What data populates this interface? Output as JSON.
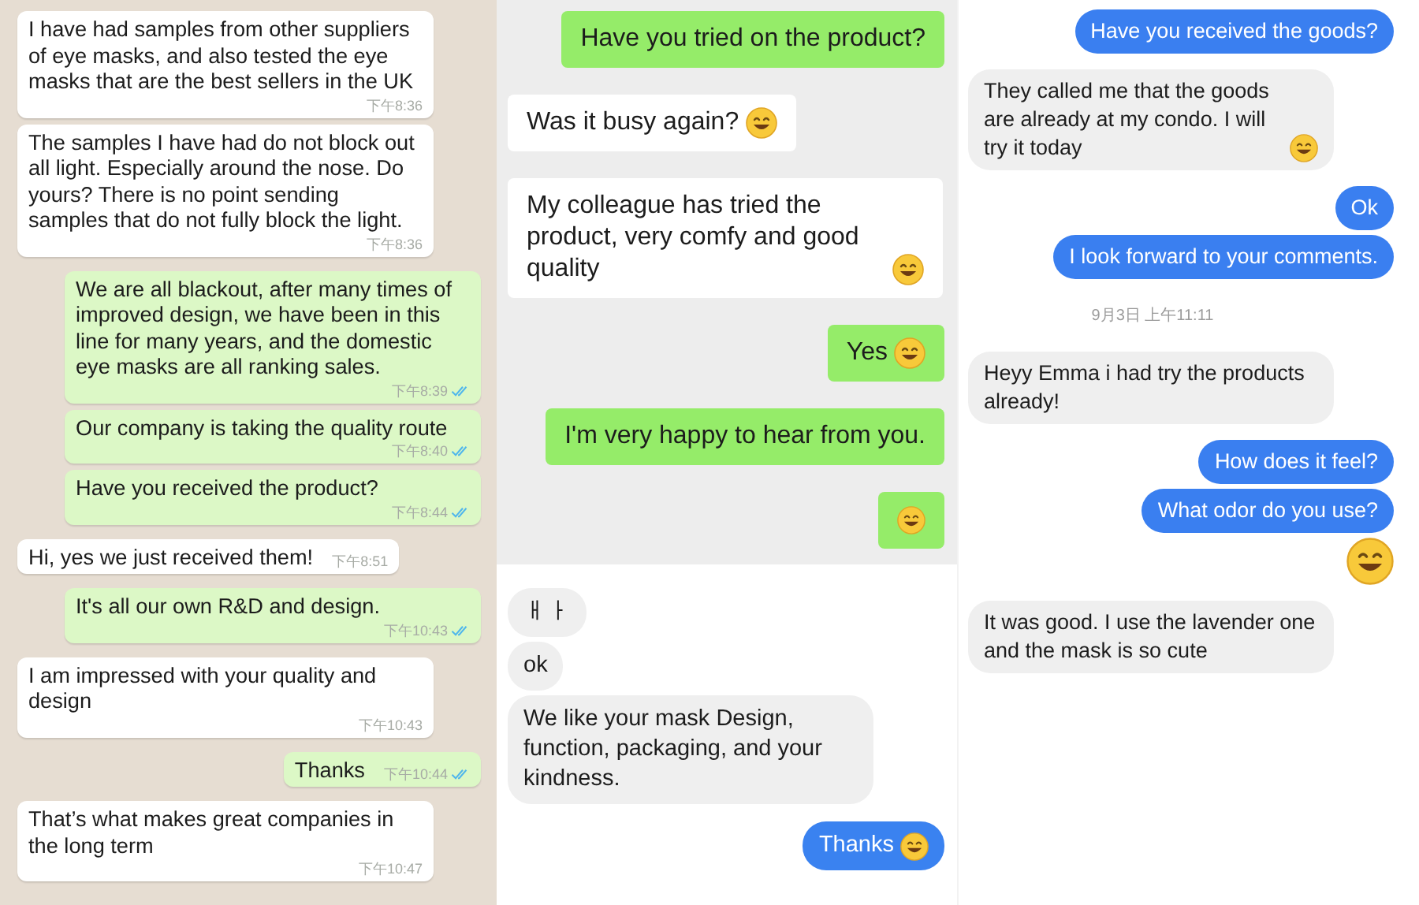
{
  "columns": [
    {
      "sections": [
        {
          "kind": "whatsapp",
          "messages": [
            {
              "kind": "message",
              "outgoing": false,
              "text": "I have had samples from other suppliers of eye masks, and also tested the eye masks that are the best sellers in the UK",
              "time": "下午8:36"
            },
            {
              "kind": "message",
              "outgoing": false,
              "text": "The samples I have had do not block out all light. Especially around the nose. Do yours? There is no point sending samples that do not fully block the light.",
              "time": "下午8:36"
            },
            {
              "kind": "message",
              "outgoing": true,
              "text": "We are all blackout, after many times of improved design, we have been in this line for many years, and the domestic eye masks are all ranking sales.",
              "time": "下午8:39",
              "read": true
            },
            {
              "kind": "message",
              "outgoing": true,
              "text": "Our company is taking the quality route",
              "time": "下午8:40",
              "read": true
            },
            {
              "kind": "message",
              "outgoing": true,
              "text": "Have you received the product?",
              "time": "下午8:44",
              "read": true
            },
            {
              "kind": "message",
              "outgoing": false,
              "text": "Hi, yes we just received them!",
              "time": "下午8:51"
            },
            {
              "kind": "message",
              "outgoing": true,
              "text": "It's all our own R&D and design.",
              "time": "下午10:43",
              "read": true
            },
            {
              "kind": "message",
              "outgoing": false,
              "text": "I am impressed with your quality and design",
              "time": "下午10:43"
            },
            {
              "kind": "message",
              "outgoing": true,
              "text": "Thanks",
              "time": "下午10:44",
              "read": true
            },
            {
              "kind": "message",
              "outgoing": false,
              "text": "That’s what makes great companies in the long term",
              "time": "下午10:47"
            }
          ]
        }
      ]
    },
    {
      "sections": [
        {
          "kind": "wechat",
          "messages": [
            {
              "kind": "message",
              "outgoing": true,
              "text": "Have you tried on the product?",
              "emoji": false
            },
            {
              "kind": "message",
              "outgoing": false,
              "text": "Was it busy again?",
              "emoji": true
            },
            {
              "kind": "message",
              "outgoing": false,
              "text": "My colleague has tried the product, very comfy and good quality",
              "emoji": true
            },
            {
              "kind": "message",
              "outgoing": true,
              "text": "Yes",
              "emoji": true
            },
            {
              "kind": "message",
              "outgoing": true,
              "text": "I'm very happy to hear from you.",
              "emoji": false
            },
            {
              "kind": "message",
              "outgoing": true,
              "emoji": true
            }
          ]
        },
        {
          "kind": "imessage",
          "messages": [
            {
              "kind": "message",
              "outgoing": false,
              "text": "ㅐㅏ",
              "emoji": false
            },
            {
              "kind": "message",
              "outgoing": false,
              "text": "ok",
              "emoji": false
            },
            {
              "kind": "message",
              "outgoing": false,
              "text": "We like your mask Design, function, packaging, and your kindness.",
              "emoji": false
            },
            {
              "kind": "message",
              "outgoing": true,
              "text": "Thanks",
              "emoji": true
            }
          ]
        }
      ]
    },
    {
      "sections": [
        {
          "kind": "messenger",
          "messages": [
            {
              "kind": "message",
              "outgoing": true,
              "text": "Have you received the goods?",
              "emoji": false
            },
            {
              "kind": "message",
              "outgoing": false,
              "text": "They called me that the goods are already at my condo. I will try it today",
              "emoji": true
            },
            {
              "kind": "message",
              "outgoing": true,
              "text": "Ok",
              "emoji": false
            },
            {
              "kind": "message",
              "outgoing": true,
              "text": "I look forward to your comments.",
              "emoji": false
            },
            {
              "kind": "date",
              "text": "9月3日 上午11:11"
            },
            {
              "kind": "message",
              "outgoing": false,
              "text": "Heyy Emma i had try the products already!",
              "emoji": false
            },
            {
              "kind": "message",
              "outgoing": true,
              "text": "How does it feel?",
              "emoji": false
            },
            {
              "kind": "message",
              "outgoing": true,
              "text": "What odor do you use?",
              "emoji": false
            },
            {
              "kind": "message",
              "outgoing": true,
              "emoji": true
            },
            {
              "kind": "message",
              "outgoing": false,
              "text": "It was good. I use the lavender one and the mask is so cute",
              "emoji": false
            }
          ]
        }
      ]
    }
  ]
}
